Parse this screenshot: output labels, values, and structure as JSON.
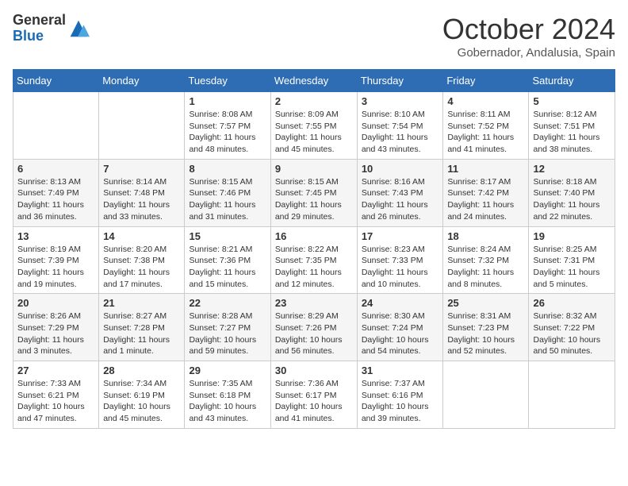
{
  "logo": {
    "text_general": "General",
    "text_blue": "Blue"
  },
  "header": {
    "month": "October 2024",
    "location": "Gobernador, Andalusia, Spain"
  },
  "weekdays": [
    "Sunday",
    "Monday",
    "Tuesday",
    "Wednesday",
    "Thursday",
    "Friday",
    "Saturday"
  ],
  "weeks": [
    [
      {
        "day": "",
        "info": ""
      },
      {
        "day": "",
        "info": ""
      },
      {
        "day": "1",
        "info": "Sunrise: 8:08 AM\nSunset: 7:57 PM\nDaylight: 11 hours and 48 minutes."
      },
      {
        "day": "2",
        "info": "Sunrise: 8:09 AM\nSunset: 7:55 PM\nDaylight: 11 hours and 45 minutes."
      },
      {
        "day": "3",
        "info": "Sunrise: 8:10 AM\nSunset: 7:54 PM\nDaylight: 11 hours and 43 minutes."
      },
      {
        "day": "4",
        "info": "Sunrise: 8:11 AM\nSunset: 7:52 PM\nDaylight: 11 hours and 41 minutes."
      },
      {
        "day": "5",
        "info": "Sunrise: 8:12 AM\nSunset: 7:51 PM\nDaylight: 11 hours and 38 minutes."
      }
    ],
    [
      {
        "day": "6",
        "info": "Sunrise: 8:13 AM\nSunset: 7:49 PM\nDaylight: 11 hours and 36 minutes."
      },
      {
        "day": "7",
        "info": "Sunrise: 8:14 AM\nSunset: 7:48 PM\nDaylight: 11 hours and 33 minutes."
      },
      {
        "day": "8",
        "info": "Sunrise: 8:15 AM\nSunset: 7:46 PM\nDaylight: 11 hours and 31 minutes."
      },
      {
        "day": "9",
        "info": "Sunrise: 8:15 AM\nSunset: 7:45 PM\nDaylight: 11 hours and 29 minutes."
      },
      {
        "day": "10",
        "info": "Sunrise: 8:16 AM\nSunset: 7:43 PM\nDaylight: 11 hours and 26 minutes."
      },
      {
        "day": "11",
        "info": "Sunrise: 8:17 AM\nSunset: 7:42 PM\nDaylight: 11 hours and 24 minutes."
      },
      {
        "day": "12",
        "info": "Sunrise: 8:18 AM\nSunset: 7:40 PM\nDaylight: 11 hours and 22 minutes."
      }
    ],
    [
      {
        "day": "13",
        "info": "Sunrise: 8:19 AM\nSunset: 7:39 PM\nDaylight: 11 hours and 19 minutes."
      },
      {
        "day": "14",
        "info": "Sunrise: 8:20 AM\nSunset: 7:38 PM\nDaylight: 11 hours and 17 minutes."
      },
      {
        "day": "15",
        "info": "Sunrise: 8:21 AM\nSunset: 7:36 PM\nDaylight: 11 hours and 15 minutes."
      },
      {
        "day": "16",
        "info": "Sunrise: 8:22 AM\nSunset: 7:35 PM\nDaylight: 11 hours and 12 minutes."
      },
      {
        "day": "17",
        "info": "Sunrise: 8:23 AM\nSunset: 7:33 PM\nDaylight: 11 hours and 10 minutes."
      },
      {
        "day": "18",
        "info": "Sunrise: 8:24 AM\nSunset: 7:32 PM\nDaylight: 11 hours and 8 minutes."
      },
      {
        "day": "19",
        "info": "Sunrise: 8:25 AM\nSunset: 7:31 PM\nDaylight: 11 hours and 5 minutes."
      }
    ],
    [
      {
        "day": "20",
        "info": "Sunrise: 8:26 AM\nSunset: 7:29 PM\nDaylight: 11 hours and 3 minutes."
      },
      {
        "day": "21",
        "info": "Sunrise: 8:27 AM\nSunset: 7:28 PM\nDaylight: 11 hours and 1 minute."
      },
      {
        "day": "22",
        "info": "Sunrise: 8:28 AM\nSunset: 7:27 PM\nDaylight: 10 hours and 59 minutes."
      },
      {
        "day": "23",
        "info": "Sunrise: 8:29 AM\nSunset: 7:26 PM\nDaylight: 10 hours and 56 minutes."
      },
      {
        "day": "24",
        "info": "Sunrise: 8:30 AM\nSunset: 7:24 PM\nDaylight: 10 hours and 54 minutes."
      },
      {
        "day": "25",
        "info": "Sunrise: 8:31 AM\nSunset: 7:23 PM\nDaylight: 10 hours and 52 minutes."
      },
      {
        "day": "26",
        "info": "Sunrise: 8:32 AM\nSunset: 7:22 PM\nDaylight: 10 hours and 50 minutes."
      }
    ],
    [
      {
        "day": "27",
        "info": "Sunrise: 7:33 AM\nSunset: 6:21 PM\nDaylight: 10 hours and 47 minutes."
      },
      {
        "day": "28",
        "info": "Sunrise: 7:34 AM\nSunset: 6:19 PM\nDaylight: 10 hours and 45 minutes."
      },
      {
        "day": "29",
        "info": "Sunrise: 7:35 AM\nSunset: 6:18 PM\nDaylight: 10 hours and 43 minutes."
      },
      {
        "day": "30",
        "info": "Sunrise: 7:36 AM\nSunset: 6:17 PM\nDaylight: 10 hours and 41 minutes."
      },
      {
        "day": "31",
        "info": "Sunrise: 7:37 AM\nSunset: 6:16 PM\nDaylight: 10 hours and 39 minutes."
      },
      {
        "day": "",
        "info": ""
      },
      {
        "day": "",
        "info": ""
      }
    ]
  ]
}
